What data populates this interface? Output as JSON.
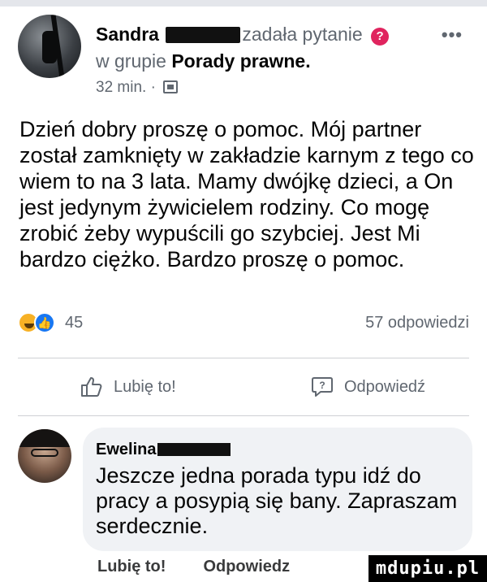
{
  "post": {
    "author": "Sandra",
    "action_text": "zadała pytanie",
    "group_prefix": "w grupie",
    "group_name": "Porady prawne.",
    "time": "32 min. ·",
    "body": "Dzień dobry proszę o pomoc. Mój partner został zamknięty w zakładzie karnym z tego co wiem to na 3 lata. Mamy dwójkę dzieci, a On jest jedynym żywicielem rodziny. Co mogę zrobić żeby wypuścili go szybciej. Jest Mi bardzo ciężko. Bardzo proszę o pomoc.",
    "reaction_count": "45",
    "comments_count": "57 odpowiedzi"
  },
  "actions": {
    "like_label": "Lubię to!",
    "reply_label": "Odpowiedź"
  },
  "comment": {
    "author": "Ewelina",
    "text": "Jeszcze jedna porada typu idź do pracy a posypią się bany. Zapraszam serdecznie.",
    "like_label": "Lubię to!",
    "reply_label": "Odpowiedz"
  },
  "icons": {
    "question_badge": "?",
    "more": "•••",
    "like_reaction": "👍"
  },
  "colors": {
    "secondary_text": "#606770",
    "like_blue": "#1877f2",
    "haha_yellow": "#f7b125",
    "question_badge": "#e0245e",
    "bubble_bg": "#f0f2f5"
  },
  "watermark": "mdupiu.pl"
}
